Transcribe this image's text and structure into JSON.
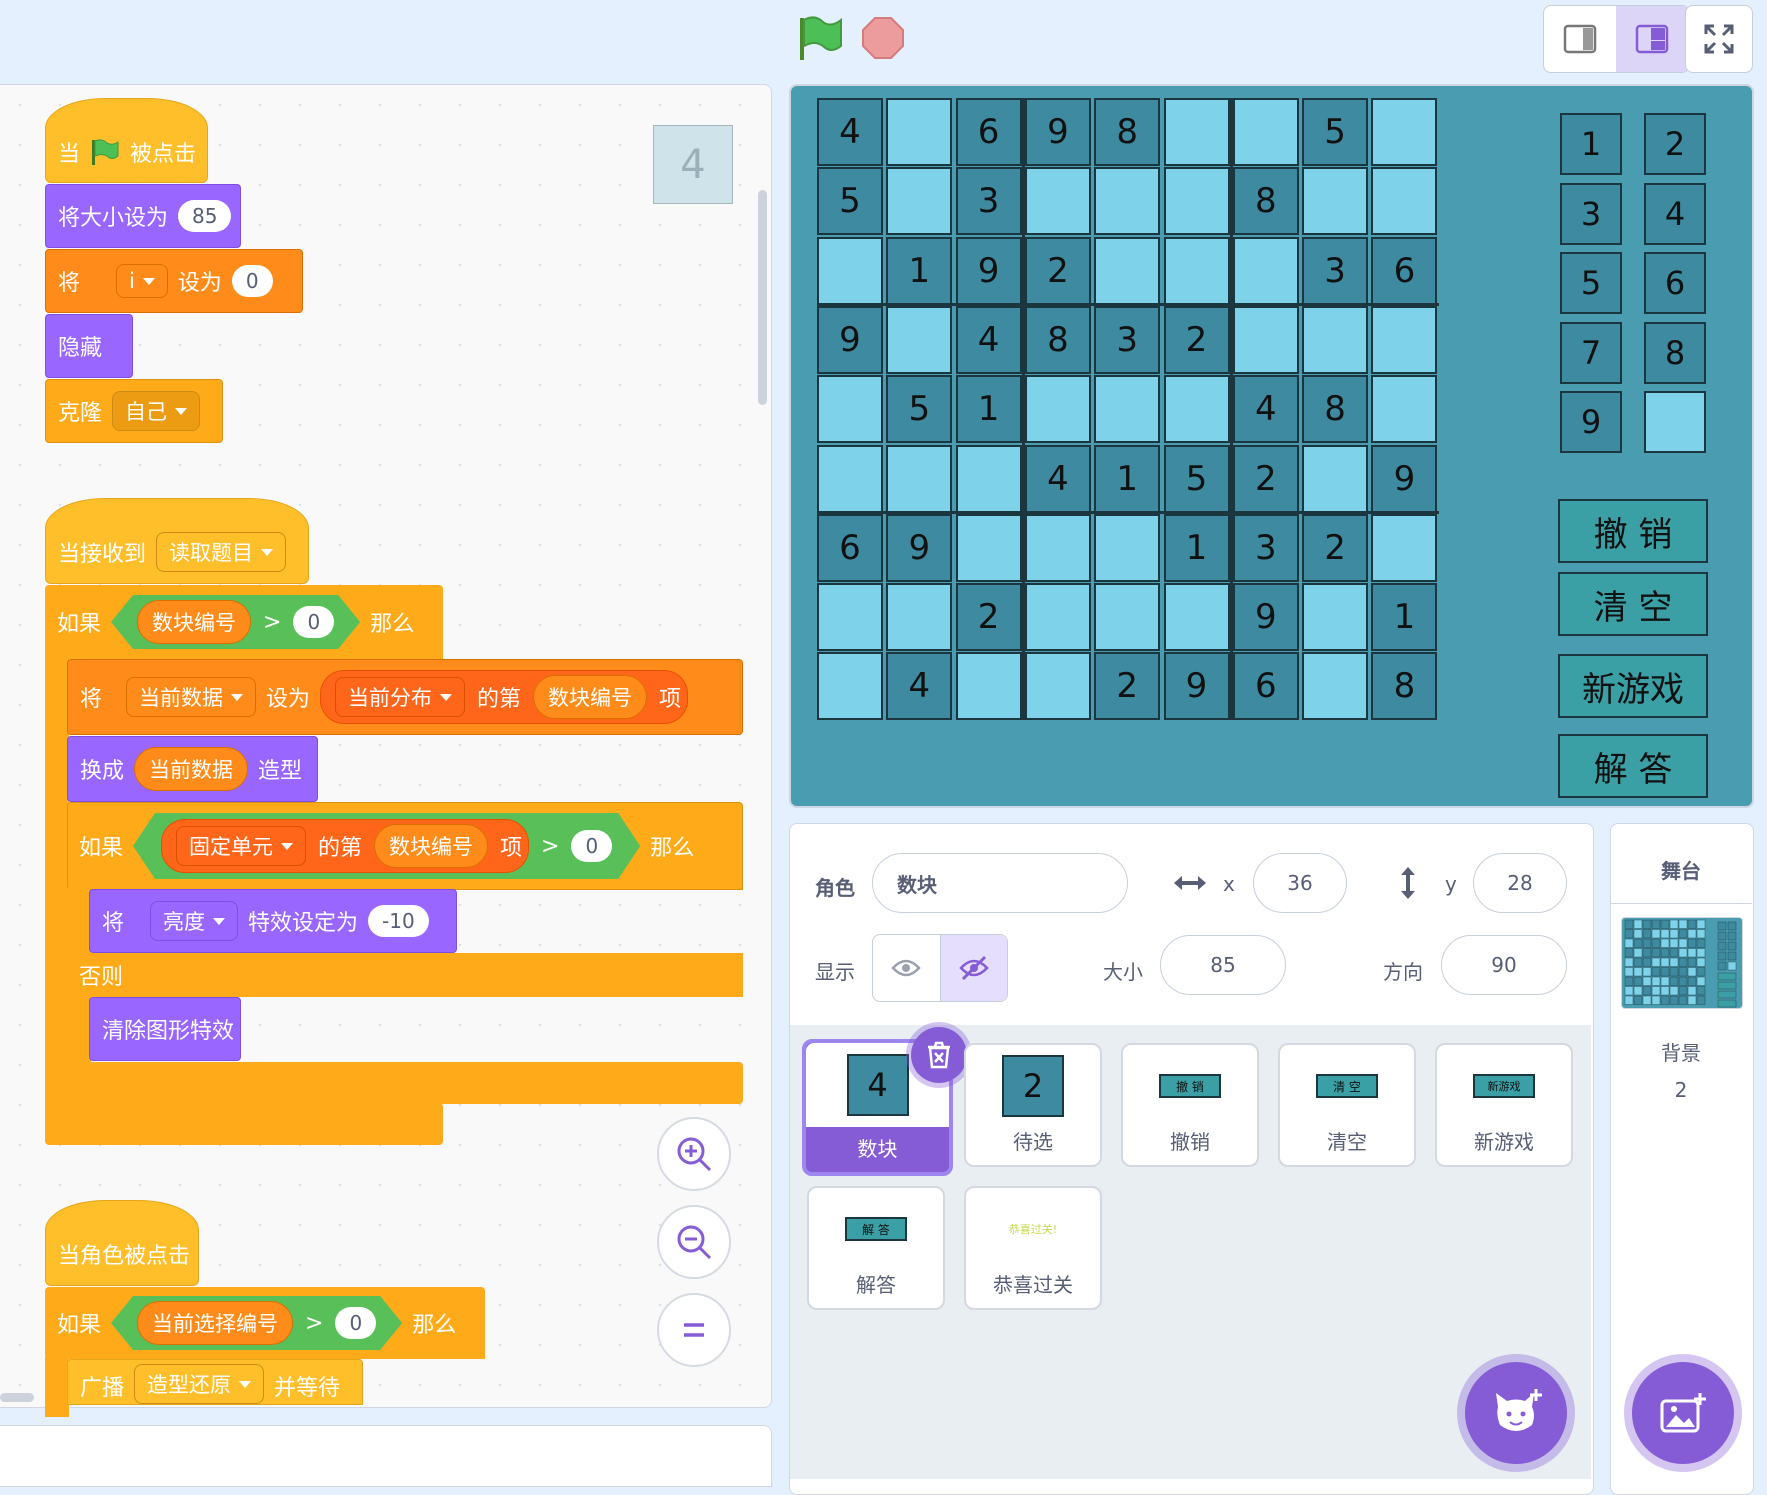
{
  "colors": {
    "accent": "#855cd6",
    "events": "#ffbf2a",
    "looks": "#9966ff",
    "variables": "#ff8c1a",
    "control": "#ffab19",
    "operators": "#59c059",
    "list": "#ff661a"
  },
  "script1": {
    "hat_pre": "当",
    "hat_post": "被点击",
    "set_size": "将大小设为",
    "set_size_val": "85",
    "set_var_pre": "将",
    "set_var_name": "i",
    "set_var_mid": "设为",
    "set_var_val": "0",
    "hide": "隐藏",
    "clone": "克隆",
    "clone_target": "自己"
  },
  "script2": {
    "hat": "当接收到",
    "message": "读取题目",
    "if1": "如果",
    "if1_var": "数块编号",
    "gt": ">",
    "zero": "0",
    "then": "那么",
    "set_pre": "将",
    "set_var": "当前数据",
    "set_mid": "设为",
    "list_name": "当前分布",
    "item_of": "的第",
    "index_var": "数块编号",
    "item": "项",
    "switch": "换成",
    "switch_var": "当前数据",
    "costume": "造型",
    "if2": "如果",
    "list2": "固定单元",
    "item_of2": "的第",
    "index_var2": "数块编号",
    "item2": "项",
    "gt2": ">",
    "zero2": "0",
    "then2": "那么",
    "effect_pre": "将",
    "effect_name": "亮度",
    "effect_mid": "特效设定为",
    "effect_val": "-10",
    "else": "否则",
    "clear": "清除图形特效"
  },
  "script3": {
    "hat": "当角色被点击",
    "if": "如果",
    "var": "当前选择编号",
    "gt": ">",
    "zero": "0",
    "then": "那么",
    "broadcast": "广播",
    "message": "造型还原",
    "wait": "并等待"
  },
  "code_sprite_thumb": "4",
  "board": {
    "rows": [
      [
        "4",
        "",
        "6",
        "9",
        "8",
        "",
        "",
        "5",
        ""
      ],
      [
        "5",
        "",
        "3",
        "",
        "",
        "",
        "8",
        "",
        ""
      ],
      [
        "",
        "1",
        "9",
        "2",
        "",
        "",
        "",
        "3",
        "6"
      ],
      [
        "9",
        "",
        "4",
        "8",
        "3",
        "2",
        "",
        "",
        ""
      ],
      [
        "",
        "5",
        "1",
        "",
        "",
        "",
        "4",
        "8",
        ""
      ],
      [
        "",
        "",
        "",
        "4",
        "1",
        "5",
        "2",
        "",
        "9"
      ],
      [
        "6",
        "9",
        "",
        "",
        "",
        "1",
        "3",
        "2",
        ""
      ],
      [
        "",
        "",
        "2",
        "",
        "",
        "",
        "9",
        "",
        "1"
      ],
      [
        "",
        "4",
        "",
        "",
        "2",
        "9",
        "6",
        "",
        "8"
      ]
    ],
    "numbers": [
      "1",
      "2",
      "3",
      "4",
      "5",
      "6",
      "7",
      "8",
      "9",
      ""
    ],
    "undo": "撤 销",
    "clear": "清 空",
    "new_game": "新游戏",
    "solve": "解 答"
  },
  "sprite_info": {
    "sprite_label": "角色",
    "sprite_name": "数块",
    "x_label": "x",
    "x": "36",
    "y_label": "y",
    "y": "28",
    "show_label": "显示",
    "size_label": "大小",
    "size": "85",
    "direction_label": "方向",
    "direction": "90"
  },
  "sprites": [
    {
      "name": "数块",
      "thumb": "4"
    },
    {
      "name": "待选",
      "thumb": "2"
    },
    {
      "name": "撤销",
      "thumb": "撤 销"
    },
    {
      "name": "清空",
      "thumb": "清 空"
    },
    {
      "name": "新游戏",
      "thumb": "新游戏"
    },
    {
      "name": "解答",
      "thumb": "解 答"
    },
    {
      "name": "恭喜过关",
      "thumb": "恭喜过关!"
    }
  ],
  "stage_pane": {
    "title": "舞台",
    "backdrop_label": "背景",
    "backdrop_count": "2"
  }
}
